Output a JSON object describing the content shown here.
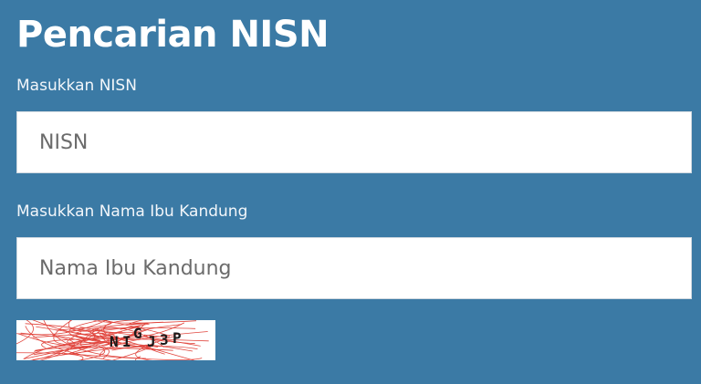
{
  "form": {
    "title": "Pencarian NISN",
    "nisn_label": "Masukkan NISN",
    "nisn_placeholder": "NISN",
    "nisn_value": "",
    "ibu_label": "Masukkan Nama Ibu Kandung",
    "ibu_placeholder": "Nama Ibu Kandung",
    "ibu_value": ""
  },
  "captcha": {
    "chars": [
      "N",
      "I",
      "G",
      "J",
      "3",
      "P"
    ],
    "background": "#ffffff",
    "line_color": "#e0443c",
    "text_color": "#1a1a1a"
  },
  "theme": {
    "page_background": "#3b7aa5"
  }
}
